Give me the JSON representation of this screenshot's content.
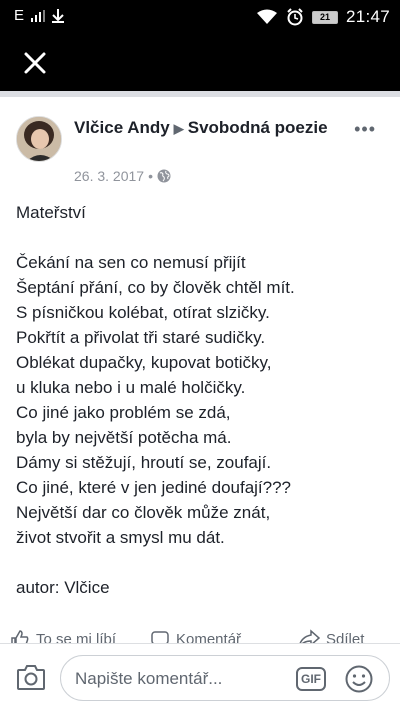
{
  "status_bar": {
    "network": "E",
    "time": "21:47",
    "battery_level": "21",
    "icons": [
      "signal-icon",
      "download-icon",
      "wifi-icon",
      "alarm-icon",
      "battery-icon"
    ]
  },
  "top_bar": {
    "close_icon": "close-icon"
  },
  "post": {
    "author": "Vlčice Andy",
    "arrow": "▶",
    "group": "Svobodná poezie",
    "date": "26. 3. 2017",
    "dot": "•",
    "privacy_icon": "globe-icon",
    "more": "•••",
    "lines": [
      "Mateřství",
      "",
      "Čekání na sen co nemusí přijít",
      "Šeptání přání, co by člověk chtěl mít.",
      "S písničkou kolébat, otírat slzičky.",
      "Pokřtít a přivolat tři staré sudičky.",
      "Oblékat dupačky, kupovat botičky,",
      "u kluka nebo i u malé holčičky.",
      "Co jiné jako problém se zdá,",
      "byla by největší potěcha má.",
      "Dámy si stěžují, hroutí se, zoufají.",
      "Co jiné, které v jen jediné doufají???",
      "Největší dar co člověk může znát,",
      "život stvořit a smysl mu dát.",
      "",
      "autor: Vlčice"
    ]
  },
  "actions": {
    "like": "To se mi líbí",
    "comment": "Komentář",
    "share": "Sdílet"
  },
  "comment_bar": {
    "placeholder": "Napište komentář...",
    "gif": "GIF"
  },
  "colors": {
    "text": "#1d2129",
    "meta": "#90949c",
    "icon": "#606770",
    "bar": "#000000"
  }
}
